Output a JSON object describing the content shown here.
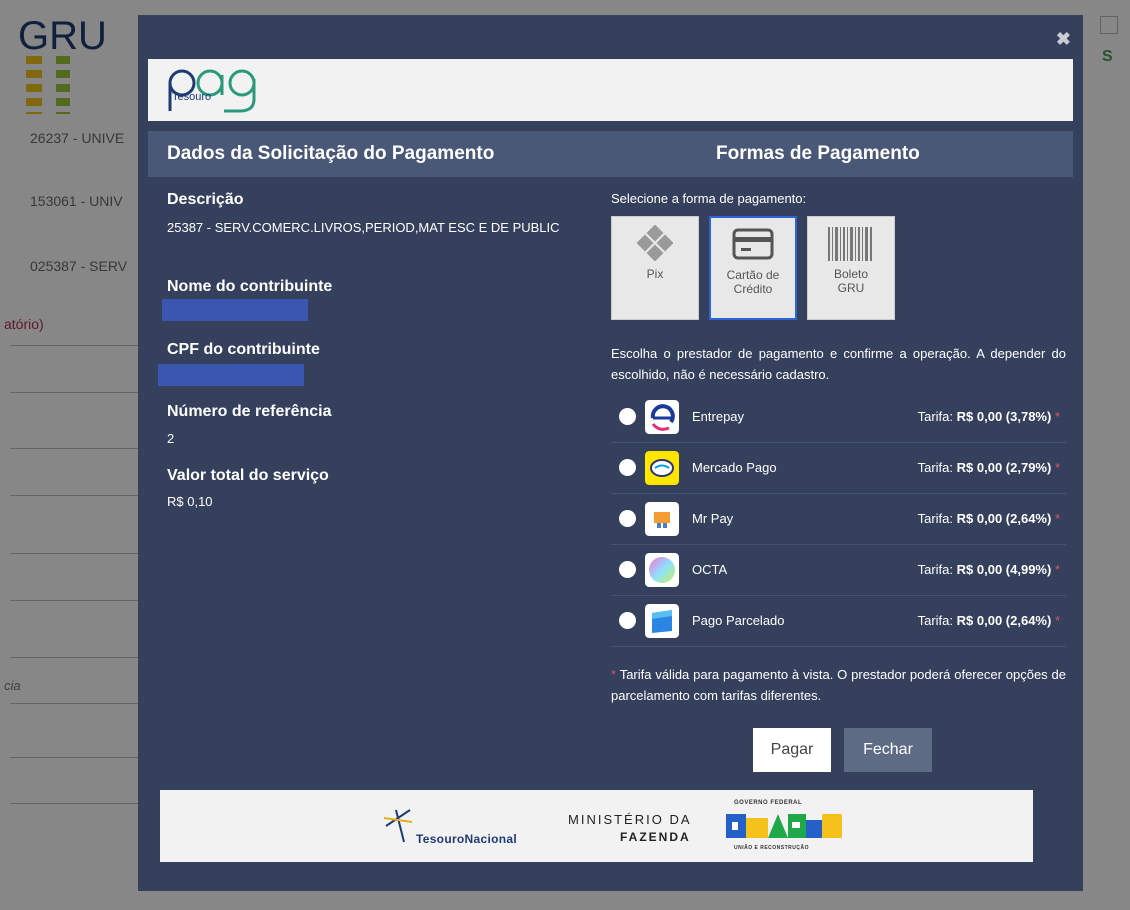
{
  "background": {
    "title": "GRU",
    "rows": [
      "26237 - UNIVE",
      "153061 - UNIV",
      "025387 - SERV"
    ],
    "required_label": "atório)",
    "italic_snippet": "cia"
  },
  "modal": {
    "close_glyph": "✖",
    "logo": {
      "wordmark": "pag",
      "sub": "Tesouro"
    },
    "left_header": "Dados da Solicitação do Pagamento",
    "right_header": "Formas de Pagamento",
    "fields": {
      "descricao_label": "Descrição",
      "descricao_value": "25387 - SERV.COMERC.LIVROS,PERIOD,MAT ESC E DE PUBLIC",
      "nome_label": "Nome do contribuinte",
      "cpf_label": "CPF do contribuinte",
      "referencia_label": "Número de referência",
      "referencia_value": "2",
      "valor_label": "Valor total do serviço",
      "valor_value": "R$ 0,10"
    },
    "select_label": "Selecione a forma de pagamento:",
    "methods": [
      {
        "line1": "Pix",
        "line2": "",
        "icon": "pix-icon",
        "selected": false
      },
      {
        "line1": "Cartão de",
        "line2": "Crédito",
        "icon": "credit-card-icon",
        "selected": true
      },
      {
        "line1": "Boleto",
        "line2": "GRU",
        "icon": "barcode-icon",
        "selected": false
      }
    ],
    "provider_intro": "Escolha o prestador de pagamento e confirme a operação. A depender do escolhido, não é necessário cadastro.",
    "tarifa_label": "Tarifa:",
    "currency": "R$",
    "providers": [
      {
        "name": "Entrepay",
        "value": "0,00 (3,78%)"
      },
      {
        "name": "Mercado Pago",
        "value": "0,00 (2,79%)"
      },
      {
        "name": "Mr Pay",
        "value": "0,00 (2,64%)"
      },
      {
        "name": "OCTA",
        "value": "0,00 (4,99%)"
      },
      {
        "name": "Pago Parcelado",
        "value": "0,00 (2,64%)"
      }
    ],
    "asterisk": "*",
    "note": "Tarifa válida para pagamento à vista. O prestador poderá oferecer opções de parcelamento com tarifas diferentes.",
    "buttons": {
      "pay": "Pagar",
      "close": "Fechar"
    },
    "footer": {
      "tesouro": "TesouroNacional",
      "ministerio_line1": "MINISTÉRIO DA",
      "ministerio_line2": "FAZENDA",
      "gov_top": "GOVERNO FEDERAL",
      "gov_bottom": "UNIÃO E RECONSTRUÇÃO"
    }
  },
  "colors": {
    "modal_bg": "#34405c",
    "header_bar": "#4a5878",
    "selected_border": "#2c66d6",
    "redaction": "#3a56b0",
    "asterisk": "#e0506a"
  }
}
